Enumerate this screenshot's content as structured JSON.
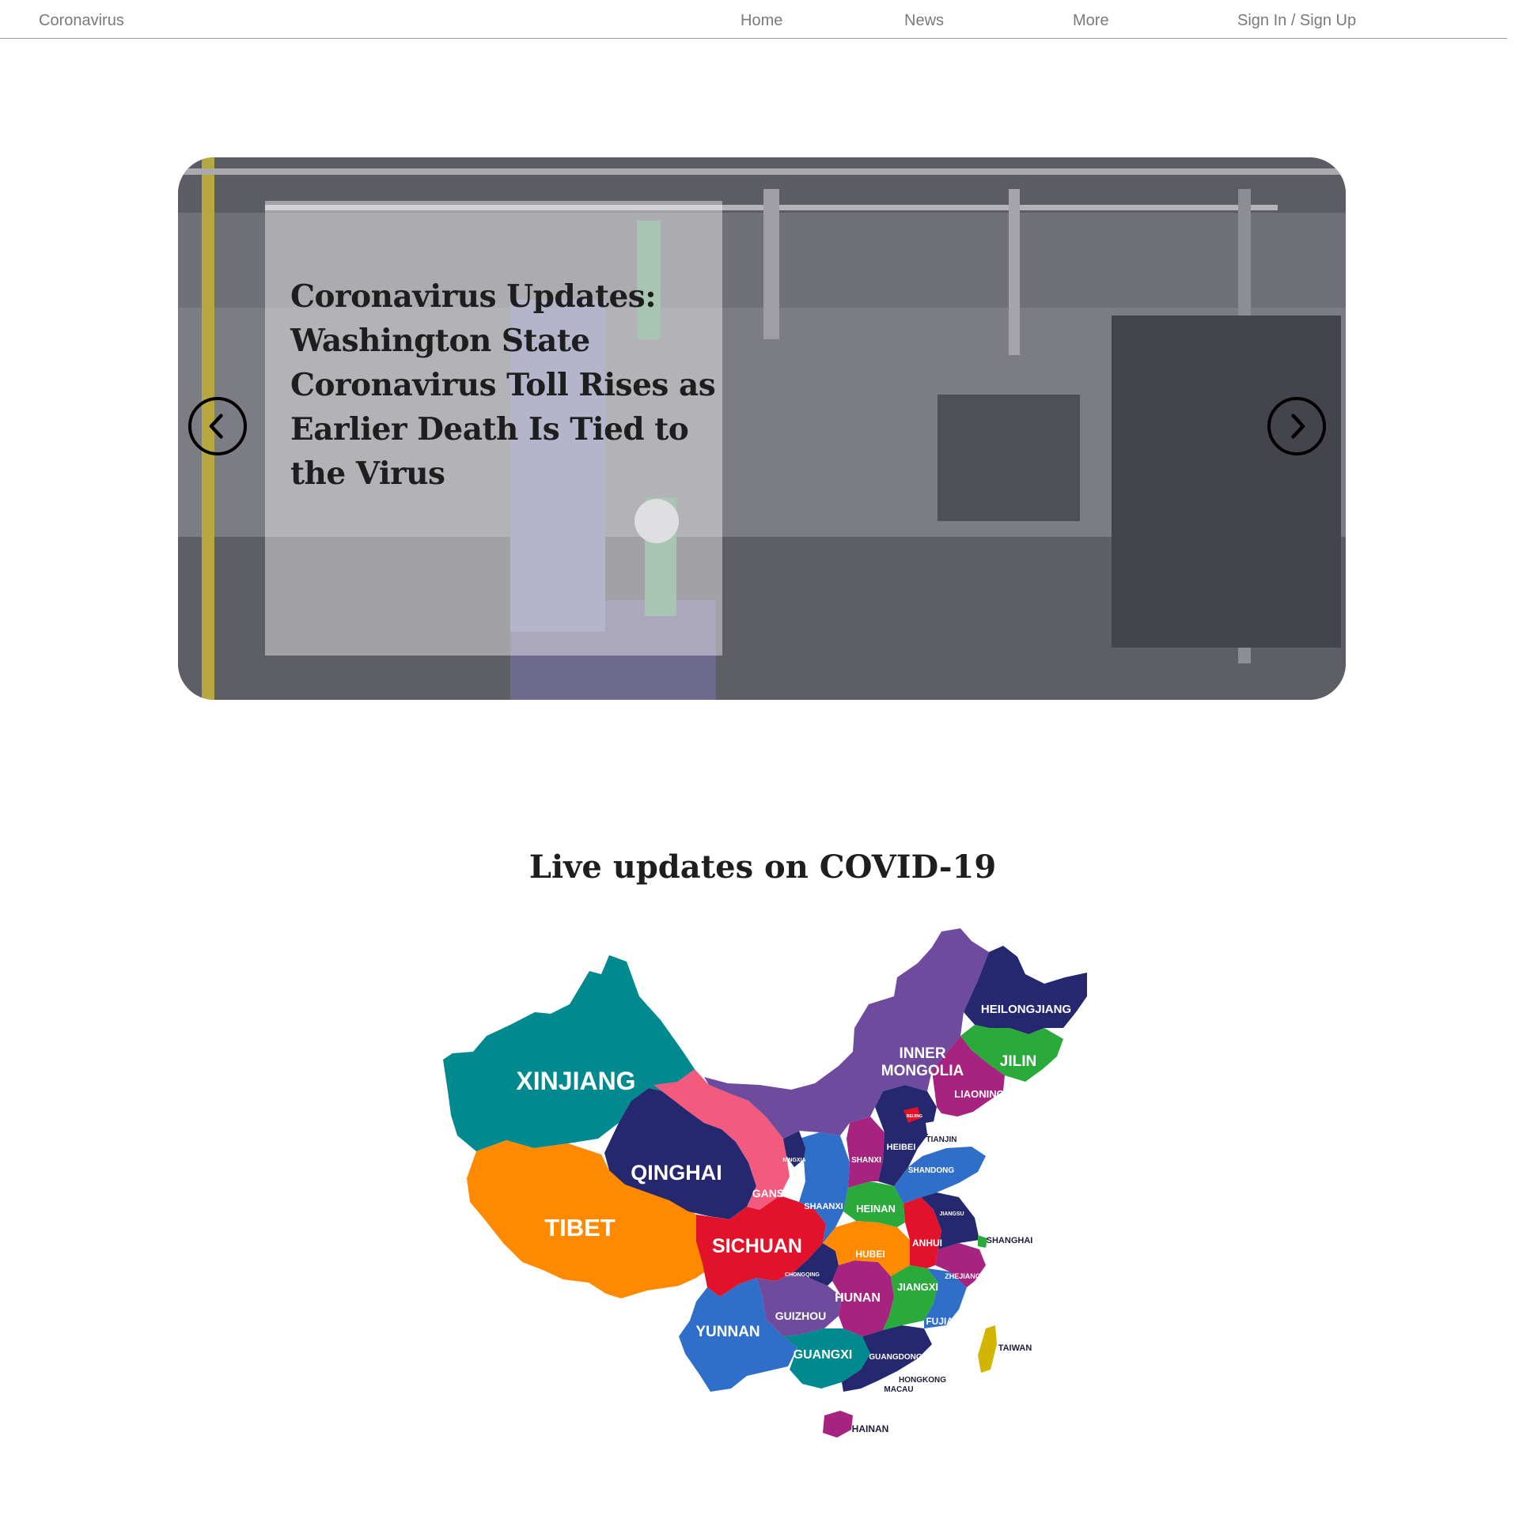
{
  "nav": {
    "brand": "Coronavirus",
    "home": "Home",
    "news": "News",
    "more": "More",
    "auth": "Sign In / Sign Up"
  },
  "hero": {
    "title": "Coronavirus Updates: Washington State Coronavirus Toll Rises as Earlier Death Is Tied to the Virus",
    "prev_icon": "chevron-left-icon",
    "next_icon": "chevron-right-icon"
  },
  "section": {
    "title": "Live updates on COVID-19"
  },
  "map": {
    "labels": {
      "xinjiang": "XINJIANG",
      "tibet": "TIBET",
      "qinghai": "QINGHAI",
      "sichuan": "SICHUAN",
      "gansu": "GANSU",
      "ningxia": "NINGXIA",
      "inner_mongolia_1": "INNER",
      "inner_mongolia_2": "MONGOLIA",
      "heilongjiang": "HEILONGJIANG",
      "jilin": "JILIN",
      "liaoning": "LIAONING",
      "beijing": "BEIJING",
      "tianjin": "TIANJIN",
      "heibei": "HEIBEI",
      "shanxi": "SHANXI",
      "shandong": "SHANDONG",
      "shaanxi": "SHAANXI",
      "heinan": "HEINAN",
      "jiangsu": "JIANGSU",
      "shanghai": "SHANGHAI",
      "anhui": "ANHUI",
      "hubei": "HUBEI",
      "zhejiang": "ZHEJIANG",
      "chongqing": "CHONGQING",
      "hunan": "HUNAN",
      "jiangxi": "JIANGXI",
      "guizhou": "GUIZHOU",
      "fujian": "FUJIAN",
      "yunnan": "YUNNAN",
      "guangxi": "GUANGXI",
      "guangdong": "GUANGDONG",
      "taiwan": "TAIWAN",
      "hongkong": "HONGKONG",
      "macau": "MACAU",
      "hainan": "HAINAN"
    },
    "colors": {
      "teal": "#008a8f",
      "orange": "#ff8a00",
      "navy": "#25286e",
      "red": "#e2122b",
      "pink": "#f25b7d",
      "purple": "#6e4b9d",
      "magenta": "#a6237f",
      "blue": "#2f6fca",
      "green": "#2aaa3a",
      "yellow": "#d1b500"
    }
  }
}
